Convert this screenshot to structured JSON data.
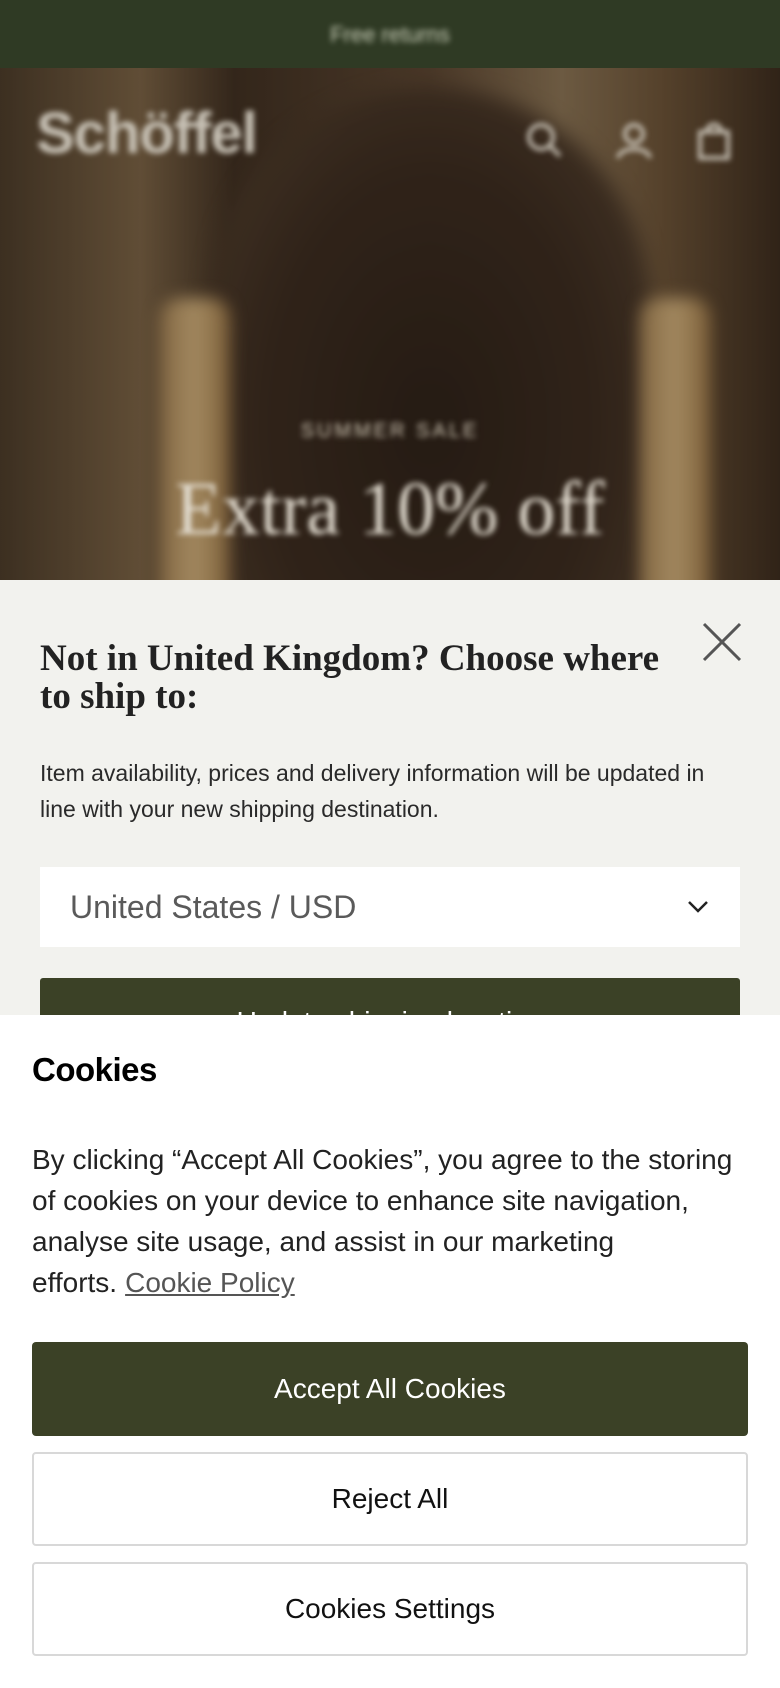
{
  "promo_bar": {
    "text": "Free returns"
  },
  "header": {
    "logo_text": "Schöffel",
    "icons": [
      "search-icon",
      "account-icon",
      "bag-icon"
    ]
  },
  "hero": {
    "eyebrow": "SUMMER SALE",
    "title": "Extra 10% off"
  },
  "shipping_modal": {
    "title": "Not in United Kingdom? Choose where to ship to:",
    "description": "Item availability, prices and delivery information will be updated in line with your new shipping destination.",
    "selected_location": "United States / USD",
    "update_button": "Update shipping location",
    "close_icon": "close-icon"
  },
  "cookies": {
    "title": "Cookies",
    "text": "By clicking “Accept All Cookies”, you agree to the storing of cookies on your device to enhance site navigation, analyse site usage, and assist in our marketing efforts.",
    "policy_link": "Cookie Policy",
    "accept_label": "Accept All Cookies",
    "reject_label": "Reject All",
    "settings_label": "Cookies Settings"
  },
  "colors": {
    "brand_green": "#3b4126",
    "promo_bar": "#2f3a24",
    "modal_bg": "#f2f2ee"
  }
}
